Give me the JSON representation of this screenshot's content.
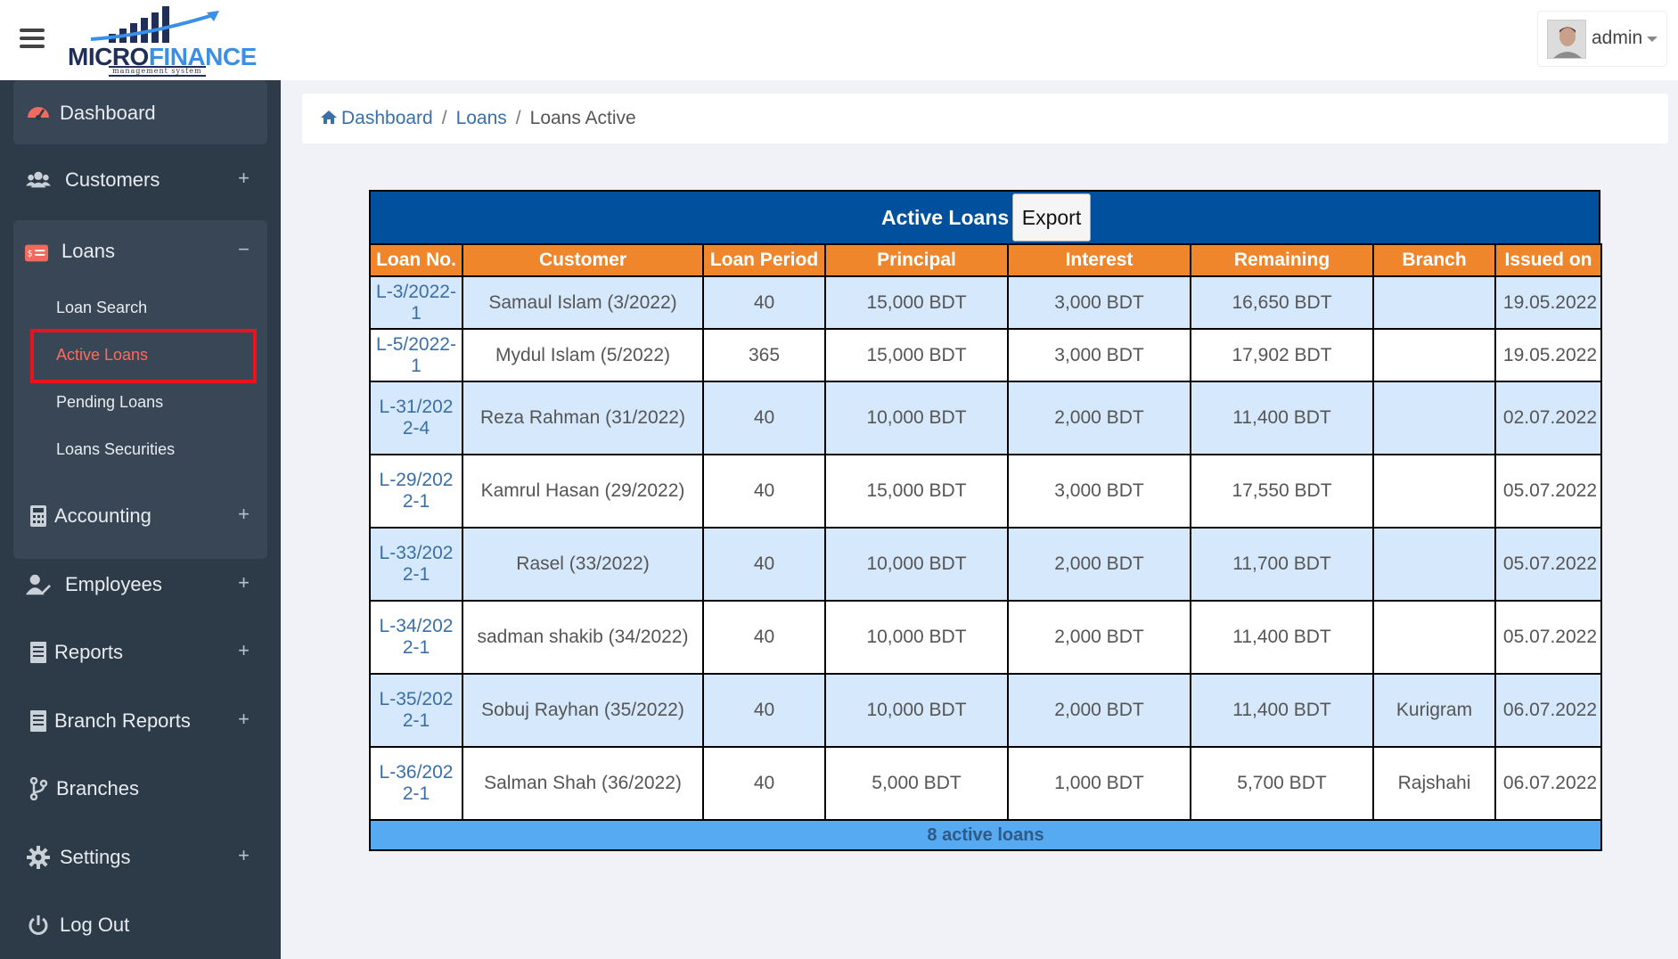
{
  "header": {
    "logo_micro": "MICRO",
    "logo_finance": "FINANCE",
    "logo_sub": "management system",
    "user_name": "admin"
  },
  "sidebar": {
    "dashboard": "Dashboard",
    "customers": "Customers",
    "loans": "Loans",
    "loans_sub": [
      "Loan Search",
      "Active Loans",
      "Pending Loans",
      "Loans Securities"
    ],
    "accounting": "Accounting",
    "employees": "Employees",
    "reports": "Reports",
    "branch_reports": "Branch Reports",
    "branches": "Branches",
    "settings": "Settings",
    "logout": "Log Out",
    "plus": "+",
    "minus": "−"
  },
  "breadcrumb": {
    "items": [
      "Dashboard",
      "Loans",
      "Loans Active"
    ],
    "separator": "/"
  },
  "table": {
    "title": "Active Loans",
    "export_label": "Export",
    "headers": [
      "Loan No.",
      "Customer",
      "Loan Period",
      "Principal",
      "Interest",
      "Remaining",
      "Branch",
      "Issued on"
    ],
    "rows": [
      [
        "L-3/2022-1",
        "Samaul Islam (3/2022)",
        "40",
        "15,000 BDT",
        "3,000 BDT",
        "16,650 BDT",
        "",
        "19.05.2022"
      ],
      [
        "L-5/2022-1",
        "Mydul Islam (5/2022)",
        "365",
        "15,000 BDT",
        "3,000 BDT",
        "17,902 BDT",
        "",
        "19.05.2022"
      ],
      [
        "L-31/2022-4",
        "Reza Rahman (31/2022)",
        "40",
        "10,000 BDT",
        "2,000 BDT",
        "11,400 BDT",
        "",
        "02.07.2022"
      ],
      [
        "L-29/2022-1",
        "Kamrul Hasan (29/2022)",
        "40",
        "15,000 BDT",
        "3,000 BDT",
        "17,550 BDT",
        "",
        "05.07.2022"
      ],
      [
        "L-33/2022-1",
        "Rasel (33/2022)",
        "40",
        "10,000 BDT",
        "2,000 BDT",
        "11,700 BDT",
        "",
        "05.07.2022"
      ],
      [
        "L-34/2022-1",
        "sadman shakib (34/2022)",
        "40",
        "10,000 BDT",
        "2,000 BDT",
        "11,400 BDT",
        "",
        "05.07.2022"
      ],
      [
        "L-35/2022-1",
        "Sobuj Rayhan (35/2022)",
        "40",
        "10,000 BDT",
        "2,000 BDT",
        "11,400 BDT",
        "Kurigram",
        "06.07.2022"
      ],
      [
        "L-36/2022-1",
        "Salman Shah (36/2022)",
        "40",
        "5,000 BDT",
        "1,000 BDT",
        "5,700 BDT",
        "Rajshahi",
        "06.07.2022"
      ]
    ],
    "footer": "8 active loans"
  },
  "colors": {
    "sidebar_bg": "#2d3a48",
    "title_bar": "#00509e",
    "header_orange": "#f0862c",
    "row_blue": "#d6e8fb",
    "footer_blue": "#55aaf2",
    "highlight_red": "#e8131c"
  }
}
